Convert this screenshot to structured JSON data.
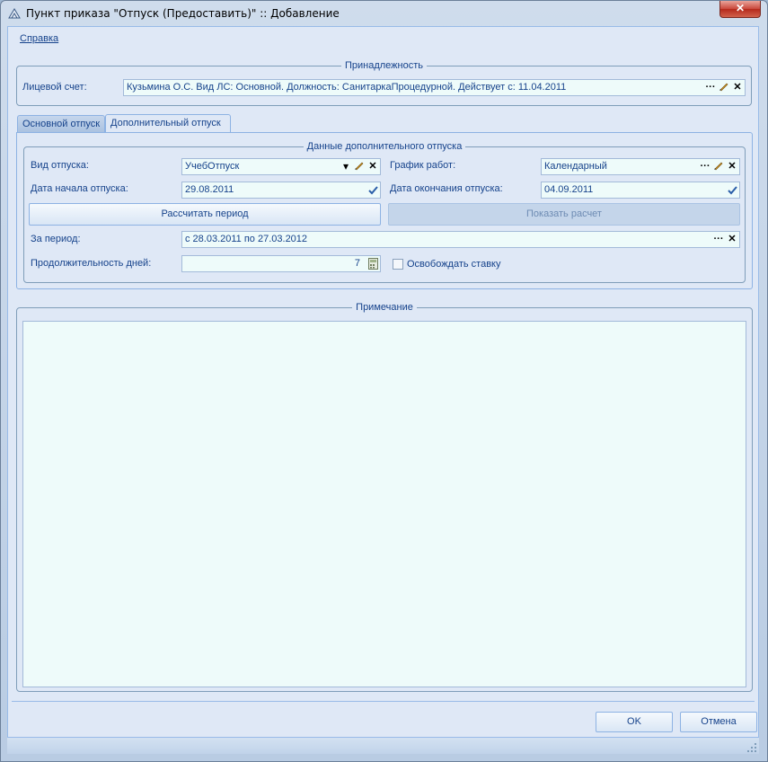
{
  "window": {
    "title": "Пункт приказа \"Отпуск (Предоставить)\" :: Добавление",
    "close_glyph": "✕"
  },
  "menu": {
    "help": "Справка"
  },
  "ownership": {
    "legend": "Принадлежность",
    "account_label": "Лицевой счет:",
    "account_value": "Кузьмина О.С. Вид ЛС: Основной. Должность: СанитаркаПроцедурной. Действует с: 11.04.2011"
  },
  "tabs": {
    "main": "Основной отпуск",
    "additional": "Дополнительный отпуск"
  },
  "vacation_data": {
    "legend": "Данные дополнительного отпуска",
    "type_label": "Вид отпуска:",
    "type_value": "УчебОтпуск",
    "schedule_label": "График работ:",
    "schedule_value": "Календарный",
    "start_label": "Дата начала отпуска:",
    "start_value": "29.08.2011",
    "end_label": "Дата окончания отпуска:",
    "end_value": "04.09.2011",
    "calc_button": "Рассчитать период",
    "show_button": "Показать расчет",
    "period_label": "За период:",
    "period_value": "с 28.03.2011 по 27.03.2012",
    "days_label": "Продолжительность дней:",
    "days_value": "7",
    "free_rate_label": "Освобождать ставку",
    "free_rate_checked": false
  },
  "note": {
    "legend": "Примечание",
    "text": ""
  },
  "footer": {
    "ok": "OK",
    "cancel": "Отмена"
  },
  "icons": {
    "ellipsis": "···",
    "clear": "✕",
    "dropdown": "▾"
  },
  "colors": {
    "accent": "#15428b",
    "panel": "#dfe8f6",
    "input_bg": "#eefbfa"
  }
}
